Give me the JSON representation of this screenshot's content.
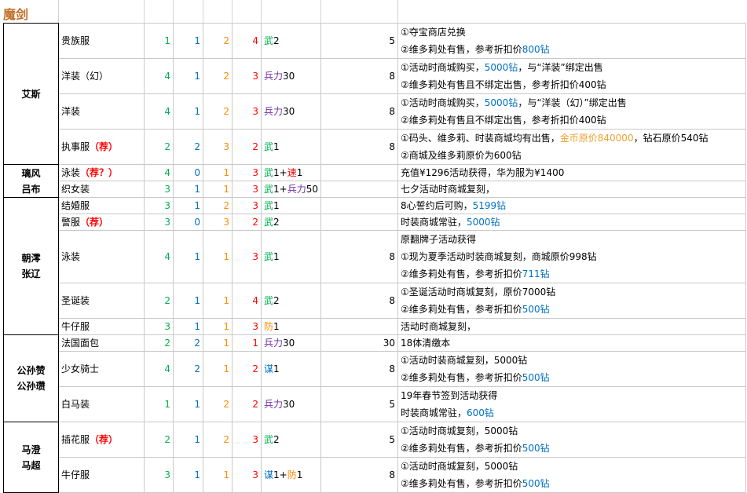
{
  "title": "魔剑",
  "colors": {
    "title": "#c2702a",
    "col1": "#00b050",
    "col2": "#0070c0",
    "col3": "#ff8c00",
    "col4": "#ff0000",
    "attr_purple": "#7030a0",
    "price_blue": "#0070c0",
    "coin_gold": "#f0a030"
  },
  "groups": [
    {
      "names": [
        "艾斯"
      ],
      "rows": [
        {
          "name": "贵族服",
          "recommend": "",
          "v1": "1",
          "v2": "1",
          "v3": "2",
          "v4": "4",
          "attr": [
            {
              "text": "武",
              "color": "green"
            },
            {
              "text": "2",
              "color": "black"
            }
          ],
          "value": "5",
          "notes": [
            [
              {
                "text": "①夺宝商店兑换",
                "color": "black"
              }
            ],
            [
              {
                "text": "②维多莉处有售，参考折扣价",
                "color": "black"
              },
              {
                "text": "800钻",
                "color": "blue"
              }
            ]
          ]
        },
        {
          "name": "洋装（幻）",
          "recommend": "",
          "v1": "4",
          "v2": "1",
          "v3": "2",
          "v4": "3",
          "attr": [
            {
              "text": "兵力",
              "color": "purple"
            },
            {
              "text": "30",
              "color": "black"
            }
          ],
          "value": "8",
          "notes": [
            [
              {
                "text": "①活动时商城购买，",
                "color": "black"
              },
              {
                "text": "5000钻",
                "color": "blue"
              },
              {
                "text": "，与“洋装”绑定出售",
                "color": "black"
              }
            ],
            [
              {
                "text": "②维多莉处有售且不绑定出售，参考折扣价400钻",
                "color": "black"
              }
            ]
          ]
        },
        {
          "name": "洋装",
          "recommend": "",
          "v1": "4",
          "v2": "1",
          "v3": "2",
          "v4": "3",
          "attr": [
            {
              "text": "兵力",
              "color": "purple"
            },
            {
              "text": "30",
              "color": "black"
            }
          ],
          "value": "8",
          "notes": [
            [
              {
                "text": "①活动时商城购买，",
                "color": "black"
              },
              {
                "text": "5000钻",
                "color": "blue"
              },
              {
                "text": "，与“洋装（幻）”绑定出售",
                "color": "black"
              }
            ],
            [
              {
                "text": "②维多莉处有售且不绑定出售，参考折扣价400钻",
                "color": "black"
              }
            ]
          ]
        },
        {
          "name": "执事服",
          "recommend": "（荐）",
          "v1": "2",
          "v2": "2",
          "v3": "3",
          "v4": "2",
          "attr": [
            {
              "text": "武",
              "color": "green"
            },
            {
              "text": "1",
              "color": "black"
            }
          ],
          "value": "8",
          "notes": [
            [
              {
                "text": "①码头、维多莉、时装商城均有出售，",
                "color": "black"
              },
              {
                "text": "金币原价840000",
                "color": "gold"
              },
              {
                "text": "，钻石原价540钻",
                "color": "black"
              }
            ],
            [
              {
                "text": "②商城及维多莉原价为600钻",
                "color": "black"
              }
            ]
          ]
        }
      ]
    },
    {
      "names": [
        "璃风",
        "吕布"
      ],
      "rows": [
        {
          "name": "泳装",
          "recommend": "（荐？）",
          "v1": "4",
          "v2": "0",
          "v3": "1",
          "v4": "3",
          "attr": [
            {
              "text": "武",
              "color": "green"
            },
            {
              "text": "1+",
              "color": "black"
            },
            {
              "text": "速",
              "color": "red"
            },
            {
              "text": "1",
              "color": "black"
            }
          ],
          "value": "",
          "notes": [
            [
              {
                "text": "充值¥1296活动获得，华为服为¥1400",
                "color": "black"
              }
            ]
          ]
        },
        {
          "name": "织女装",
          "recommend": "",
          "v1": "3",
          "v2": "1",
          "v3": "1",
          "v4": "3",
          "attr": [
            {
              "text": "武",
              "color": "green"
            },
            {
              "text": "1+",
              "color": "black"
            },
            {
              "text": "兵力",
              "color": "purple"
            },
            {
              "text": "50",
              "color": "black"
            }
          ],
          "value": "",
          "notes": [
            [
              {
                "text": "七夕活动时商城复刻，",
                "color": "black"
              }
            ]
          ]
        }
      ]
    },
    {
      "names": [
        "朝澪",
        "张辽"
      ],
      "rows": [
        {
          "name": "结婚服",
          "recommend": "",
          "v1": "3",
          "v2": "1",
          "v3": "2",
          "v4": "3",
          "attr": [
            {
              "text": "武",
              "color": "green"
            },
            {
              "text": "1",
              "color": "black"
            }
          ],
          "value": "",
          "notes": [
            [
              {
                "text": "8心誓约后可购，",
                "color": "black"
              },
              {
                "text": "5199钻",
                "color": "blue"
              }
            ]
          ]
        },
        {
          "name": "警服",
          "recommend": "（荐）",
          "v1": "3",
          "v2": "0",
          "v3": "3",
          "v4": "2",
          "attr": [
            {
              "text": "武",
              "color": "green"
            },
            {
              "text": "2",
              "color": "black"
            }
          ],
          "value": "",
          "notes": [
            [
              {
                "text": "时装商城常驻，",
                "color": "black"
              },
              {
                "text": "5000钻",
                "color": "blue"
              }
            ]
          ]
        },
        {
          "name": "泳装",
          "recommend": "",
          "v1": "4",
          "v2": "1",
          "v3": "1",
          "v4": "3",
          "attr": [
            {
              "text": "武",
              "color": "green"
            },
            {
              "text": "1",
              "color": "black"
            }
          ],
          "value": "8",
          "notes": [
            [
              {
                "text": "原翻牌子活动获得",
                "color": "black"
              }
            ],
            [
              {
                "text": "①现为夏季活动时装商城复刻，商城原价998钻",
                "color": "black"
              }
            ],
            [
              {
                "text": "②维多莉处有售，参考折扣价",
                "color": "black"
              },
              {
                "text": "711钻",
                "color": "blue"
              }
            ]
          ]
        },
        {
          "name": "圣诞装",
          "recommend": "",
          "v1": "2",
          "v2": "1",
          "v3": "1",
          "v4": "4",
          "attr": [
            {
              "text": "武",
              "color": "green"
            },
            {
              "text": "2",
              "color": "black"
            }
          ],
          "value": "8",
          "notes": [
            [
              {
                "text": "①圣诞活动时商城复刻，原价7000钻",
                "color": "black"
              }
            ],
            [
              {
                "text": "②维多莉处有售，参考折扣价",
                "color": "black"
              },
              {
                "text": "500钻",
                "color": "blue"
              }
            ]
          ]
        },
        {
          "name": "牛仔服",
          "recommend": "",
          "v1": "3",
          "v2": "1",
          "v3": "1",
          "v4": "3",
          "attr": [
            {
              "text": "防",
              "color": "orange"
            },
            {
              "text": "1",
              "color": "black"
            }
          ],
          "value": "",
          "notes": [
            [
              {
                "text": "活动时商城复刻，",
                "color": "black"
              }
            ]
          ]
        }
      ]
    },
    {
      "names": [
        "公孙赞",
        "公孙瓒"
      ],
      "rows": [
        {
          "name": "法国面包",
          "recommend": "",
          "v1": "2",
          "v2": "2",
          "v3": "1",
          "v4": "1",
          "attr": [
            {
              "text": "兵力",
              "color": "purple"
            },
            {
              "text": "30",
              "color": "black"
            }
          ],
          "value": "30",
          "notes": [
            [
              {
                "text": "18体清缴本",
                "color": "black"
              }
            ]
          ]
        },
        {
          "name": "少女骑士",
          "recommend": "",
          "v1": "4",
          "v2": "2",
          "v3": "1",
          "v4": "2",
          "attr": [
            {
              "text": "谋",
              "color": "blue"
            },
            {
              "text": "1",
              "color": "black"
            }
          ],
          "value": "8",
          "notes": [
            [
              {
                "text": "①活动时装商城复刻，5000钻",
                "color": "black"
              }
            ],
            [
              {
                "text": "②维多莉处有售，参考折扣价",
                "color": "black"
              },
              {
                "text": "500钻",
                "color": "blue"
              }
            ]
          ]
        },
        {
          "name": "白马装",
          "recommend": "",
          "v1": "1",
          "v2": "1",
          "v3": "2",
          "v4": "2",
          "attr": [
            {
              "text": "兵力",
              "color": "purple"
            },
            {
              "text": "30",
              "color": "black"
            }
          ],
          "value": "5",
          "notes": [
            [
              {
                "text": "19年春节签到活动获得",
                "color": "black"
              }
            ],
            [
              {
                "text": "时装商城常驻，",
                "color": "black"
              },
              {
                "text": "600钻",
                "color": "blue"
              }
            ]
          ]
        }
      ]
    },
    {
      "names": [
        "马澄",
        "马超"
      ],
      "rows": [
        {
          "name": "插花服",
          "recommend": "（荐）",
          "v1": "2",
          "v2": "1",
          "v3": "2",
          "v4": "3",
          "attr": [
            {
              "text": "武",
              "color": "green"
            },
            {
              "text": "2",
              "color": "black"
            }
          ],
          "value": "5",
          "notes": [
            [
              {
                "text": "①活动时商城复刻，5000钻",
                "color": "black"
              }
            ],
            [
              {
                "text": "②维多莉处有售，参考折扣价",
                "color": "black"
              },
              {
                "text": "500钻",
                "color": "blue"
              }
            ]
          ]
        },
        {
          "name": "牛仔服",
          "recommend": "",
          "v1": "3",
          "v2": "1",
          "v3": "1",
          "v4": "3",
          "attr": [
            {
              "text": "谋",
              "color": "blue"
            },
            {
              "text": "1+",
              "color": "black"
            },
            {
              "text": "防",
              "color": "orange"
            },
            {
              "text": "1",
              "color": "black"
            }
          ],
          "value": "8",
          "notes": [
            [
              {
                "text": "①活动时商城复刻，5000钻",
                "color": "black"
              }
            ],
            [
              {
                "text": "②维多莉处有售，参考折扣价",
                "color": "black"
              },
              {
                "text": "500钻",
                "color": "blue"
              }
            ]
          ]
        }
      ]
    }
  ]
}
